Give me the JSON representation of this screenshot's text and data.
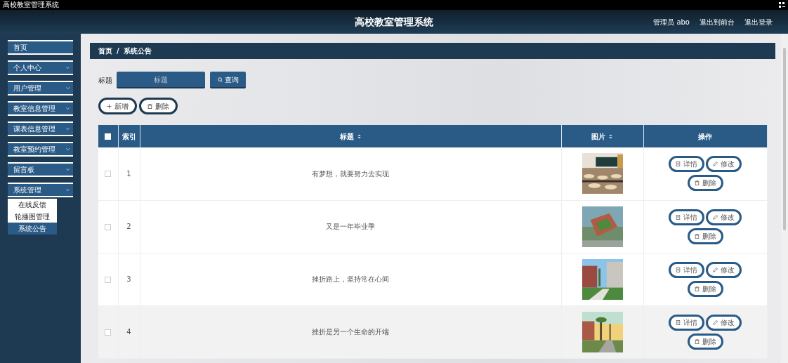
{
  "window": {
    "title": "高校教室管理系统"
  },
  "header": {
    "title": "高校教室管理系统",
    "links": [
      "管理员 abo",
      "退出到前台",
      "退出登录"
    ]
  },
  "sidebar": {
    "items": [
      {
        "label": "首页",
        "expandable": false
      },
      {
        "label": "个人中心",
        "expandable": true
      },
      {
        "label": "用户管理",
        "expandable": true
      },
      {
        "label": "教室信息管理",
        "expandable": true
      },
      {
        "label": "课表信息管理",
        "expandable": true
      },
      {
        "label": "教室预约管理",
        "expandable": true
      },
      {
        "label": "留言板",
        "expandable": true
      },
      {
        "label": "系统管理",
        "expandable": true,
        "children": [
          {
            "label": "在线反馈",
            "selected": false
          },
          {
            "label": "轮播图管理",
            "selected": false
          },
          {
            "label": "系统公告",
            "selected": true
          }
        ]
      }
    ]
  },
  "breadcrumb": {
    "items": [
      "首页",
      "系统公告"
    ],
    "separator": "/"
  },
  "search": {
    "label": "标题",
    "placeholder": "标题",
    "button": "查询"
  },
  "toolbar": [
    {
      "label": "新增",
      "kind": "add"
    },
    {
      "label": "删除",
      "kind": "delete"
    }
  ],
  "table": {
    "select_all": {
      "checked": false
    },
    "columns": [
      {
        "label": "索引",
        "sortable": false
      },
      {
        "label": "标题",
        "sortable": true
      },
      {
        "label": "图片",
        "sortable": true
      },
      {
        "label": "操作",
        "sortable": false
      }
    ],
    "rows": [
      {
        "index": "1",
        "title": "有梦想，就要努力去实现",
        "image": {
          "kind": "picture"
        },
        "checked": false,
        "highlighted": false,
        "actions": [
          {
            "label": "详情",
            "kind": "detail"
          },
          {
            "label": "修改",
            "kind": "edit"
          },
          {
            "label": "删除",
            "kind": "delete"
          }
        ]
      },
      {
        "index": "2",
        "title": "又是一年毕业季",
        "image": {
          "kind": "picture"
        },
        "checked": false,
        "highlighted": false,
        "actions": [
          {
            "label": "详情",
            "kind": "detail"
          },
          {
            "label": "修改",
            "kind": "edit"
          },
          {
            "label": "删除",
            "kind": "delete"
          }
        ]
      },
      {
        "index": "3",
        "title": "挫折路上，坚持常在心间",
        "image": {
          "kind": "picture"
        },
        "checked": false,
        "highlighted": false,
        "actions": [
          {
            "label": "详情",
            "kind": "detail"
          },
          {
            "label": "修改",
            "kind": "edit"
          },
          {
            "label": "删除",
            "kind": "delete"
          }
        ]
      },
      {
        "index": "4",
        "title": "挫折是另一个生命的开端",
        "image": {
          "kind": "picture"
        },
        "checked": false,
        "highlighted": true,
        "actions": [
          {
            "label": "详情",
            "kind": "detail"
          },
          {
            "label": "修改",
            "kind": "edit"
          },
          {
            "label": "删除",
            "kind": "delete"
          }
        ]
      }
    ]
  }
}
